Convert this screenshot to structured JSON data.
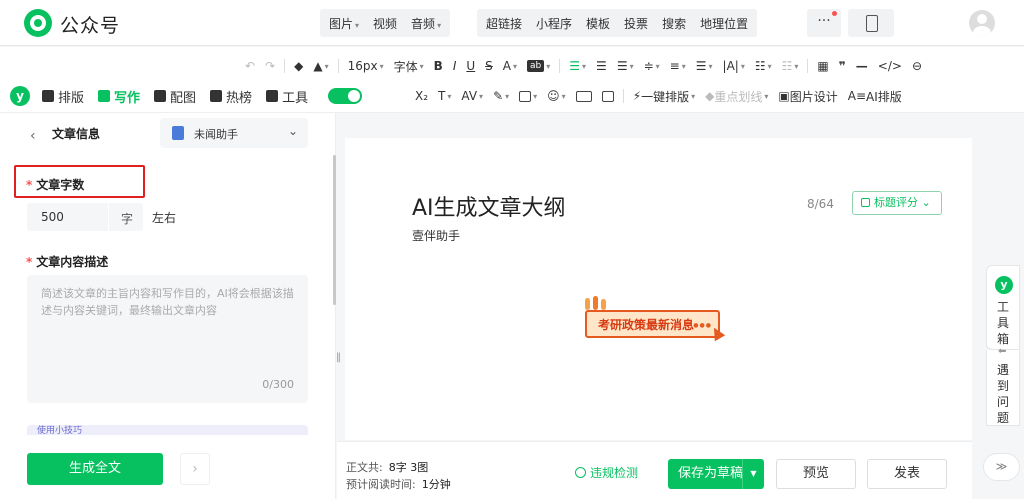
{
  "header": {
    "brand": "公众号",
    "media_buttons": [
      "图片",
      "视频",
      "音频"
    ],
    "insert_buttons": [
      "超链接",
      "小程序",
      "模板",
      "投票",
      "搜索",
      "地理位置"
    ],
    "more": "···"
  },
  "toolbar": {
    "font_size": "16px",
    "font_family": "字体",
    "bold": "B",
    "italic": "I",
    "underline": "U",
    "strike": "S",
    "font_color": "A",
    "quote": "❞",
    "hr": "—",
    "code": "</>",
    "subscript": "X₂",
    "letter_spacing": "AV",
    "one_click_layout": "一键排版",
    "highlight_line": "重点划线",
    "image_design": "图片设计",
    "ai_layout": "AI排版"
  },
  "assistant_tabs": [
    {
      "label": "排版",
      "active": false
    },
    {
      "label": "写作",
      "active": true
    },
    {
      "label": "配图",
      "active": false
    },
    {
      "label": "热榜",
      "active": false
    },
    {
      "label": "工具",
      "active": false
    }
  ],
  "left_panel": {
    "title": "文章信息",
    "assistant_name": "未闻助手",
    "word_count_label": "文章字数",
    "word_count_value": "500",
    "word_count_unit": "字",
    "word_count_suffix": "左右",
    "description_label": "文章内容描述",
    "description_placeholder": "简述该文章的主旨内容和写作目的，AI将会根据该描述与内容关键词，最终输出文章内容",
    "description_counter": "0/300",
    "tips": "使用小技巧",
    "generate_button": "生成全文"
  },
  "editor": {
    "title": "AI生成文章大纲",
    "title_count": "8/64",
    "title_score_button": "标题评分",
    "author": "壹伴助手",
    "banner_text": "考研政策最新消息"
  },
  "footer": {
    "body_label": "正文共:",
    "body_value": "8字 3图",
    "read_label": "预计阅读时间:",
    "read_value": "1分钟",
    "violation_check": "违规检测",
    "save_draft": "保存为草稿",
    "preview": "预览",
    "publish": "发表"
  },
  "side": {
    "toolbox": "工具箱",
    "help": "遇到问题"
  },
  "colors": {
    "accent": "#07c160",
    "highlight_border": "#e02020",
    "banner": "#e45a21"
  }
}
